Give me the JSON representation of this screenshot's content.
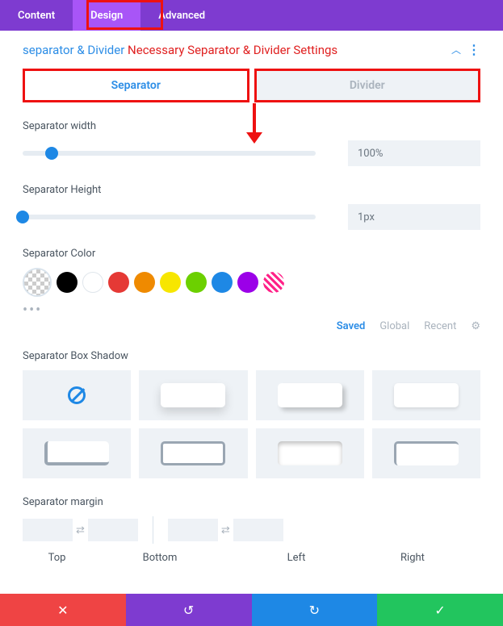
{
  "tabs": {
    "content": "Content",
    "design": "Design",
    "advanced": "Advanced"
  },
  "section": {
    "title_a": "separator & Divider",
    "title_b": "Necessary Separator & Divider Settings"
  },
  "subtabs": {
    "separator": "Separator",
    "divider": "Divider"
  },
  "width": {
    "label": "Separator width",
    "value": "100%",
    "pct": 10
  },
  "height": {
    "label": "Separator Height",
    "value": "1px",
    "pct": 0
  },
  "color": {
    "label": "Separator Color",
    "swatches": [
      "#000000",
      "#ffffff",
      "#e53935",
      "#ef8a00",
      "#f7e600",
      "#6cd000",
      "#1e88e5",
      "#9b00e8"
    ]
  },
  "presets": {
    "saved": "Saved",
    "global": "Global",
    "recent": "Recent"
  },
  "shadow": {
    "label": "Separator Box Shadow"
  },
  "margin": {
    "label": "Separator margin",
    "top": "Top",
    "bottom": "Bottom",
    "left": "Left",
    "right": "Right"
  }
}
